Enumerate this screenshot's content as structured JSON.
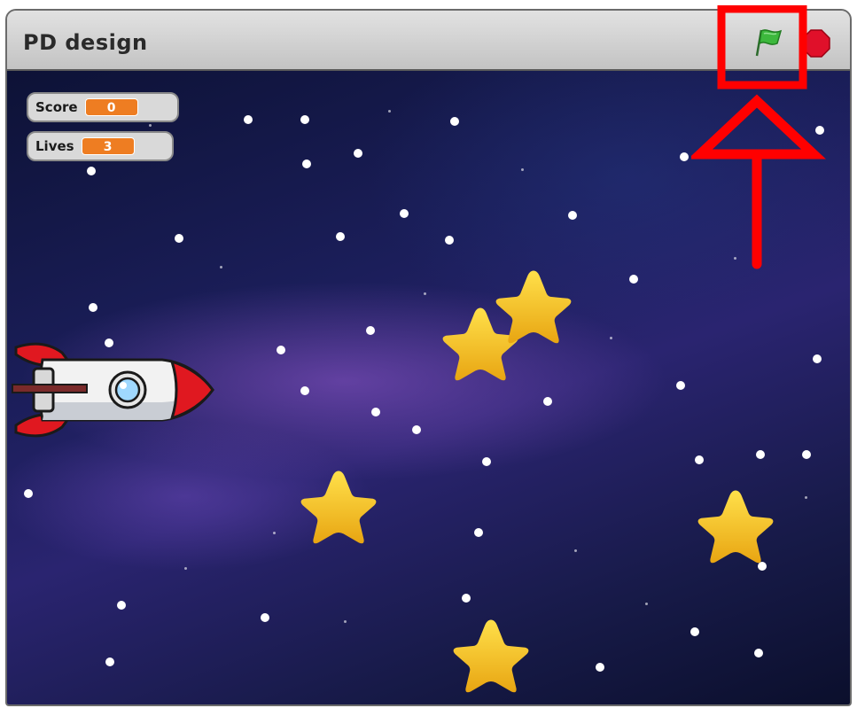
{
  "window": {
    "title": "PD design"
  },
  "toolbar": {
    "green_flag_icon": "green-flag-icon",
    "stop_icon": "stop-sign-icon"
  },
  "monitors": {
    "score": {
      "label": "Score",
      "value": "0"
    },
    "lives": {
      "label": "Lives",
      "value": "3"
    }
  },
  "colors": {
    "monitor_value": "#ee7d22",
    "annotation": "#ff0000",
    "flag": "#3db83d",
    "stop": "#e0102a",
    "star": "#f5c518"
  }
}
